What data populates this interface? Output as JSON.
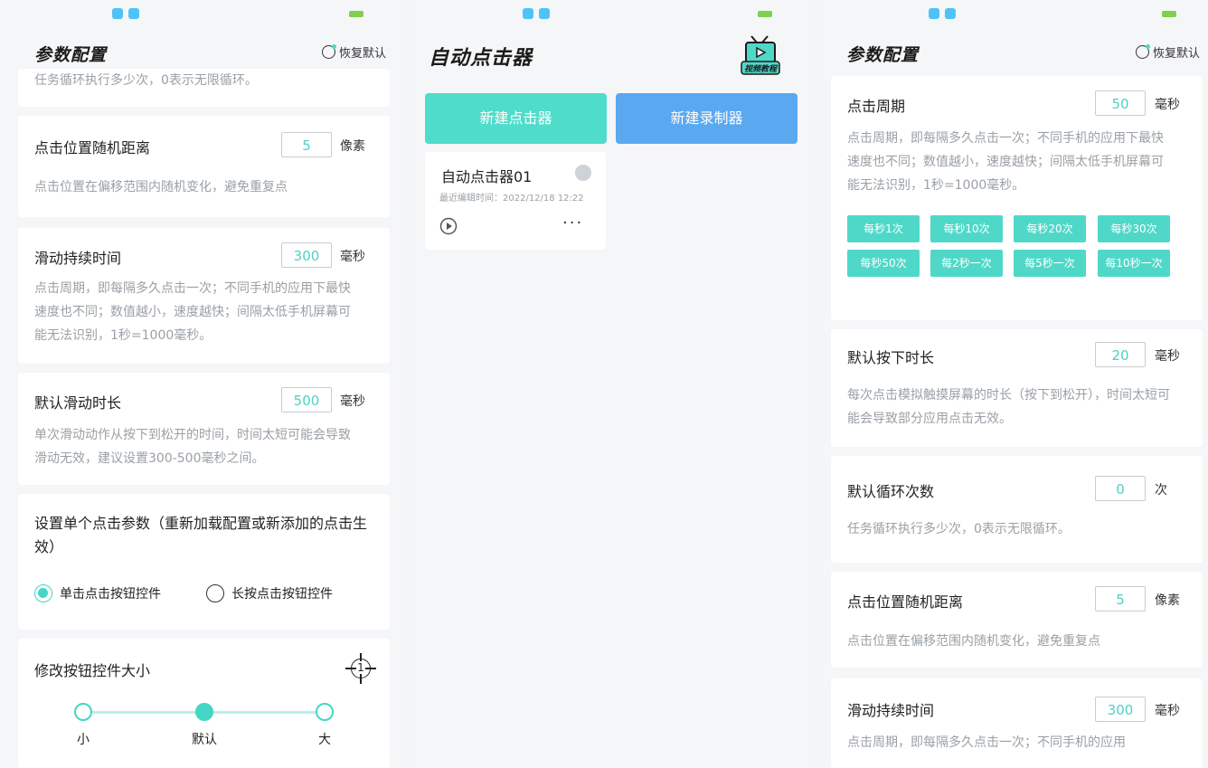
{
  "colors": {
    "accent": "#45d6c6",
    "blue_button": "#5aa8ef",
    "bg": "#f5f6f8"
  },
  "left_panel": {
    "title": "参数配置",
    "restore_label": "恢复默认",
    "loop_desc_partial": "任务循环执行多少次，0表示无限循环。",
    "random_distance": {
      "label": "点击位置随机距离",
      "value": "5",
      "unit": "像素",
      "desc": "点击位置在偏移范围内随机变化，避免重复点"
    },
    "swipe_duration": {
      "label": "滑动持续时间",
      "value": "300",
      "unit": "毫秒",
      "desc": "点击周期，即每隔多久点击一次；不同手机的应用下最快速度也不同；数值越小，速度越快；间隔太低手机屏幕可能无法识别，1秒=1000毫秒。"
    },
    "default_swipe": {
      "label": "默认滑动时长",
      "value": "500",
      "unit": "毫秒",
      "desc": "单次滑动动作从按下到松开的时间，时间太短可能会导致滑动无效，建议设置300-500毫秒之间。"
    },
    "single_click": {
      "label": "设置单个点击参数（重新加载配置或新添加的点击生效）",
      "option1": "单击点击按钮控件",
      "option2": "长按点击按钮控件"
    },
    "button_size": {
      "label": "修改按钮控件大小",
      "target_num": "1",
      "small": "小",
      "default": "默认",
      "large": "大"
    }
  },
  "middle_panel": {
    "title": "自动点击器",
    "video_label": "视频教程",
    "new_clicker": "新建点击器",
    "new_recorder": "新建录制器",
    "item": {
      "name": "自动点击器01",
      "edited": "最近编辑时间：2022/12/18 12:22",
      "more": "···"
    }
  },
  "right_panel": {
    "title": "参数配置",
    "restore_label": "恢复默认",
    "click_period": {
      "label": "点击周期",
      "value": "50",
      "unit": "毫秒",
      "desc": "点击周期，即每隔多久点击一次；不同手机的应用下最快速度也不同；数值越小，速度越快；间隔太低手机屏幕可能无法识别，1秒=1000毫秒。"
    },
    "presets": [
      "每秒1次",
      "每秒10次",
      "每秒20次",
      "每秒30次",
      "每秒50次",
      "每2秒一次",
      "每5秒一次",
      "每10秒一次"
    ],
    "default_press": {
      "label": "默认按下时长",
      "value": "20",
      "unit": "毫秒",
      "desc": "每次点击模拟触摸屏幕的时长（按下到松开），时间太短可能会导致部分应用点击无效。"
    },
    "default_loops": {
      "label": "默认循环次数",
      "value": "0",
      "unit": "次",
      "desc": "任务循环执行多少次，0表示无限循环。"
    },
    "random_distance": {
      "label": "点击位置随机距离",
      "value": "5",
      "unit": "像素",
      "desc": "点击位置在偏移范围内随机变化，避免重复点"
    },
    "swipe_duration": {
      "label": "滑动持续时间",
      "value": "300",
      "unit": "毫秒",
      "desc": "点击周期，即每隔多久点击一次；不同手机的应用"
    }
  }
}
